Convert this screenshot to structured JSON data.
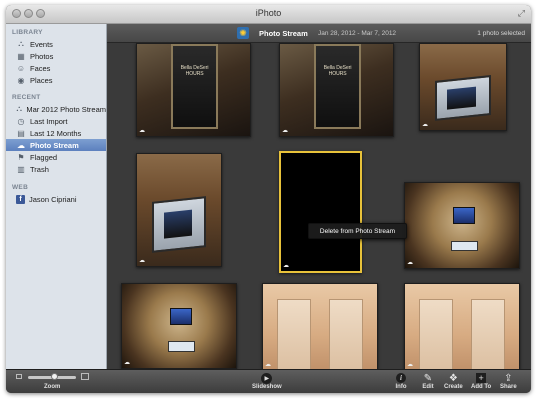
{
  "window": {
    "title": "iPhoto"
  },
  "sidebar": {
    "library_heading": "LIBRARY",
    "recent_heading": "RECENT",
    "web_heading": "WEB",
    "library_items": [
      {
        "label": "Events",
        "icon": "events-icon"
      },
      {
        "label": "Photos",
        "icon": "photos-icon"
      },
      {
        "label": "Faces",
        "icon": "faces-icon"
      },
      {
        "label": "Places",
        "icon": "places-icon"
      }
    ],
    "recent_items": [
      {
        "label": "Mar 2012 Photo Stream",
        "icon": "event-icon"
      },
      {
        "label": "Last Import",
        "icon": "clock-icon"
      },
      {
        "label": "Last 12 Months",
        "icon": "calendar-icon"
      },
      {
        "label": "Photo Stream",
        "icon": "photo-stream-icon",
        "selected": true
      },
      {
        "label": "Flagged",
        "icon": "flag-icon"
      },
      {
        "label": "Trash",
        "icon": "trash-icon"
      }
    ],
    "web_items": [
      {
        "label": "Jason Cipriani",
        "icon": "facebook-icon"
      }
    ]
  },
  "header": {
    "title": "Photo Stream",
    "date_range": "Jan 28, 2012 - Mar 7, 2012",
    "selection": "1 photo selected"
  },
  "context_menu": {
    "item": "Delete from Photo Stream"
  },
  "door_sign": {
    "name": "Bella DeSeri",
    "hours": "HOURS"
  },
  "toolbar": {
    "zoom_label": "Zoom",
    "slideshow_label": "Slideshow",
    "info_label": "Info",
    "edit_label": "Edit",
    "create_label": "Create",
    "add_to_label": "Add To",
    "share_label": "Share"
  },
  "colors": {
    "selection": "#e8c23a",
    "sidebar_bg": "#dde3ea",
    "sidebar_selected": "#6b8ec7",
    "content_bg": "#3a3a3a"
  }
}
